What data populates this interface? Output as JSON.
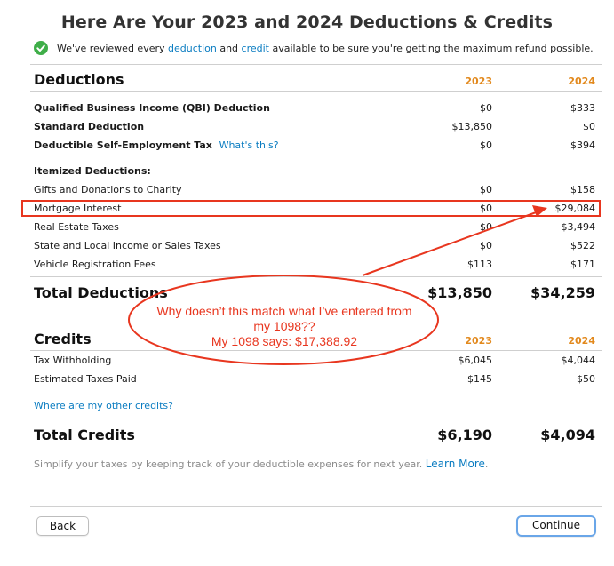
{
  "page": {
    "title": "Here Are Your 2023 and 2024 Deductions & Credits",
    "notice": {
      "prefix": "We've reviewed every ",
      "link1": "deduction",
      "middle": " and ",
      "link2": "credit",
      "suffix": " available to be sure you're getting the maximum refund possible.",
      "icon": "check-circle-icon"
    }
  },
  "deductions": {
    "heading": "Deductions",
    "year1": "2023",
    "year2": "2024",
    "rows": [
      {
        "label": "Qualified Business Income (QBI) Deduction",
        "v2023": "$0",
        "v2024": "$333"
      },
      {
        "label": "Standard Deduction",
        "v2023": "$13,850",
        "v2024": "$0"
      },
      {
        "label": "Deductible Self-Employment Tax",
        "link": "What's this?",
        "v2023": "$0",
        "v2024": "$394"
      }
    ],
    "itemized_heading": "Itemized Deductions:",
    "itemized": [
      {
        "label": "Gifts and Donations to Charity",
        "v2023": "$0",
        "v2024": "$158"
      },
      {
        "label": "Mortgage Interest",
        "v2023": "$0",
        "v2024": "$29,084"
      },
      {
        "label": "Real Estate Taxes",
        "v2023": "$0",
        "v2024": "$3,494"
      },
      {
        "label": "State and Local Income or Sales Taxes",
        "v2023": "$0",
        "v2024": "$522"
      },
      {
        "label": "Vehicle Registration Fees",
        "v2023": "$113",
        "v2024": "$171"
      }
    ],
    "total_label": "Total Deductions",
    "total_2023": "$13,850",
    "total_2024": "$34,259"
  },
  "credits": {
    "heading": "Credits",
    "year1": "2023",
    "year2": "2024",
    "rows": [
      {
        "label": "Tax Withholding",
        "v2023": "$6,045",
        "v2024": "$4,044"
      },
      {
        "label": "Estimated Taxes Paid",
        "v2023": "$145",
        "v2024": "$50"
      }
    ],
    "other_link": "Where are my other credits?",
    "total_label": "Total Credits",
    "total_2023": "$6,190",
    "total_2024": "$4,094"
  },
  "footer": {
    "note": "Simplify your taxes by keeping track of your deductible expenses for next year. ",
    "learn_more": "Learn More",
    "period": "."
  },
  "annotation": {
    "line1": "Why doesn’t this match what I’ve entered from",
    "line2": "my 1098??",
    "line3": "My 1098 says: $17,388.92",
    "color": "#e8361f"
  },
  "buttons": {
    "back": "Back",
    "continue": "Continue"
  }
}
